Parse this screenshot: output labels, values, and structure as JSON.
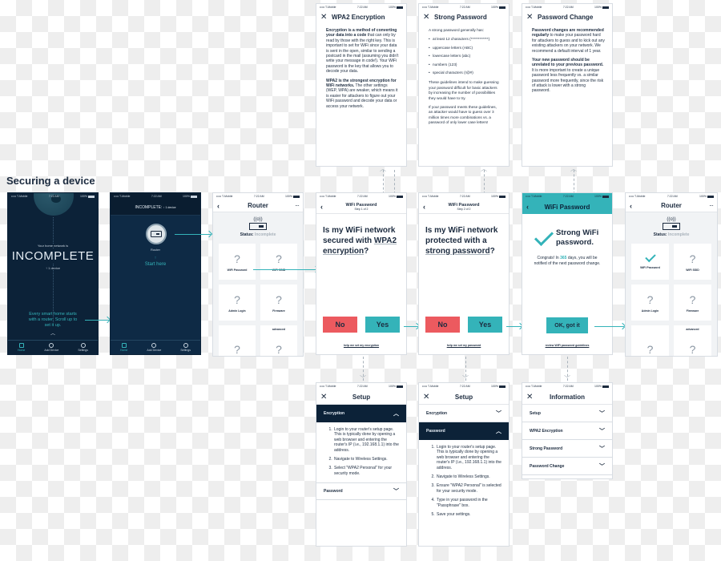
{
  "section_title": "Securing a device",
  "status_bar": {
    "carrier": "••••• T-Mobile",
    "time": "7:22 AM",
    "battery": "100%"
  },
  "home_screen": {
    "subtitle": "Your home network is",
    "headline": "INCOMPLETE",
    "device_count": "1 device",
    "prompt": "Every smart home starts with a router. Scroll up to set it up.",
    "tabs": [
      {
        "label": "Home",
        "icon": "home-icon"
      },
      {
        "label": "Add Device",
        "icon": "add-device-icon"
      },
      {
        "label": "Settings",
        "icon": "settings-icon"
      }
    ]
  },
  "router_start_screen": {
    "header": "INCOMPLETE:",
    "header_count": "1 device",
    "device_label": "Router",
    "cta": "Start here"
  },
  "router_screen": {
    "title": "Router",
    "status_label": "Status:",
    "status_value": "Incomplete",
    "tiles": [
      "WiFi Password",
      "WiFi SSID",
      "Admin Login",
      "Firmware",
      "",
      "advanced"
    ]
  },
  "wpa2_info": {
    "title": "WPA2 Encryption",
    "p1_bold": "Encryption is a method of converting your data into a code",
    "p1_rest": " that can only by read by those with the right key. This is important to set for WiFi since your data is sent in the open, similar to sending a postcard in the mail (assuming you didn't write your message in code!). Your WiFi password is the key that allows you to decode your data.",
    "p2_bold": "WPA2 is the strongest encryption for WiFi networks.",
    "p2_rest": " The other settings (WEP, WPA) are weaker, which means it is easier for attackers to figure out your WiFi password and decode your data or access your network."
  },
  "strong_password_info": {
    "title": "Strong Password",
    "intro": "A strong password generally has:",
    "bullets": [
      "at least 12 characters (************)",
      "uppercase letters (ABC)",
      "lowercase letters (abc)",
      "numbers (123)",
      "special characters (!@#)"
    ],
    "p1": "These guidelines intend to make guessing your password difficult for basic attackers by increasing the number of possibilities they would have to try.",
    "p2": "If your password meets these guidelines, an attacker would have to guess over 3 million times more combinations vs. a password of only lower case letters!"
  },
  "password_change_info": {
    "title": "Password Change",
    "p1_bold": "Password changes are recommended regularly",
    "p1_rest": " to make your password hard for attackers to guess and to kick out any existing attackers on your network. We recommend a default interval of 1 year.",
    "p2_bold": "Your new password should be unrelated to your previous password.",
    "p2_rest": " It is more important to create a unique password less frequently vs. a similar password more frequently, since the risk of attack is lower with a strong password."
  },
  "step1": {
    "title": "WiFi Password",
    "step": "Step 1 of 2",
    "q_pre": "Is my WiFi network secured with ",
    "q_link": "WPA2 encryption",
    "q_post": "?",
    "no": "No",
    "yes": "Yes",
    "help": "help me set my encryption"
  },
  "step2": {
    "title": "WiFi Password",
    "step": "Step 2 of 2",
    "q_pre": "Is my WiFi network protected with a ",
    "q_link": "strong password",
    "q_post": "?",
    "no": "No",
    "yes": "Yes",
    "help": "help me set my password"
  },
  "success": {
    "title": "WiFi Password",
    "headline": "Strong WiFi password.",
    "msg_pre": "Congrats! In ",
    "msg_days": "365",
    "msg_post": " days, you will be notified of the next password change.",
    "ok": "OK, got it",
    "review": "review WiFi password guidelines"
  },
  "setup_encryption": {
    "title": "Setup",
    "sections": [
      "Encryption",
      "Password"
    ],
    "steps": [
      "Login to your router's setup page. This is typically done by opening a web browser and entering the router's IP (i.e., 192.168.1.1) into the address.",
      "Navigate to Wireless Settings.",
      "Select \"WPA2 Personal\" for your security mode."
    ]
  },
  "setup_password": {
    "title": "Setup",
    "sections": [
      "Encryption",
      "Password"
    ],
    "steps": [
      "Login to your router's setup page. This is typically done by opening a web browser and entering the router's IP (i.e., 192.168.1.1) into the address.",
      "Navigate to Wireless Settings.",
      "Ensure \"WPA2 Personal\" is selected for your security mode.",
      "Type in your password in the \"Passphrase\" box.",
      "Save your settings."
    ]
  },
  "information": {
    "title": "Information",
    "items": [
      "Setup",
      "WPA2 Encryption",
      "Strong Password",
      "Password Change"
    ]
  },
  "colors": {
    "navy": "#0c2238",
    "teal": "#34b3b9",
    "red": "#ec5a5f",
    "text": "#1c2b3f"
  }
}
